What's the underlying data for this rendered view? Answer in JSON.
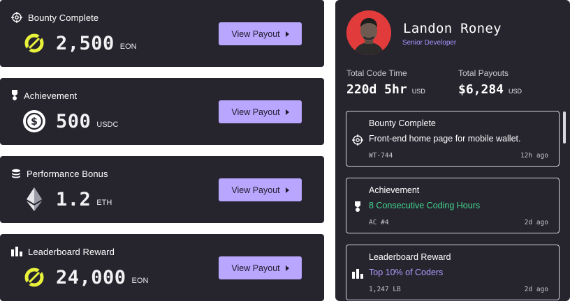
{
  "cards": [
    {
      "title": "Bounty Complete",
      "icon": "crosshair-icon",
      "coin": "eon-coin-icon",
      "value": "2,500",
      "unit": "EON",
      "button": "View Payout"
    },
    {
      "title": "Achievement",
      "icon": "medal-icon",
      "coin": "usdc-coin-icon",
      "value": "500",
      "unit": "USDC",
      "button": "View Payout"
    },
    {
      "title": "Performance Bonus",
      "icon": "coins-stack-icon",
      "coin": "ethereum-icon",
      "value": "1.2",
      "unit": "ETH",
      "button": "View Payout"
    },
    {
      "title": "Leaderboard Reward",
      "icon": "bar-chart-icon",
      "coin": "eon-coin-icon",
      "value": "24,000",
      "unit": "EON",
      "button": "View Payout"
    }
  ],
  "profile": {
    "name": "Landon Roney",
    "role": "Senior Developer",
    "stats": [
      {
        "label": "Total Code Time",
        "value": "220d 5hr",
        "unit": "USD"
      },
      {
        "label": "Total Payouts",
        "value": "$6,284",
        "unit": "USD"
      }
    ],
    "feed": [
      {
        "title": "Bounty Complete",
        "icon": "crosshair-icon",
        "desc": "Front-end home page for mobile wallet.",
        "code": "WT-744",
        "time": "12h ago"
      },
      {
        "title": "Achievement",
        "icon": "medal-icon",
        "desc": "8 Consecutive Coding Hours",
        "code": "AC #4",
        "time": "2d ago"
      },
      {
        "title": "Leaderboard Reward",
        "icon": "bar-chart-icon",
        "desc": "Top 10% of Coders",
        "code": "1,247 LB",
        "time": "2d ago"
      }
    ]
  },
  "colors": {
    "card_bg": "#26252e",
    "button_bg": "#b9a6ff",
    "eon_yellow": "#e9f23a",
    "achievement_green": "#43d68f",
    "leaderboard_purple": "#b39cff",
    "avatar_bg": "#e23b3b"
  }
}
